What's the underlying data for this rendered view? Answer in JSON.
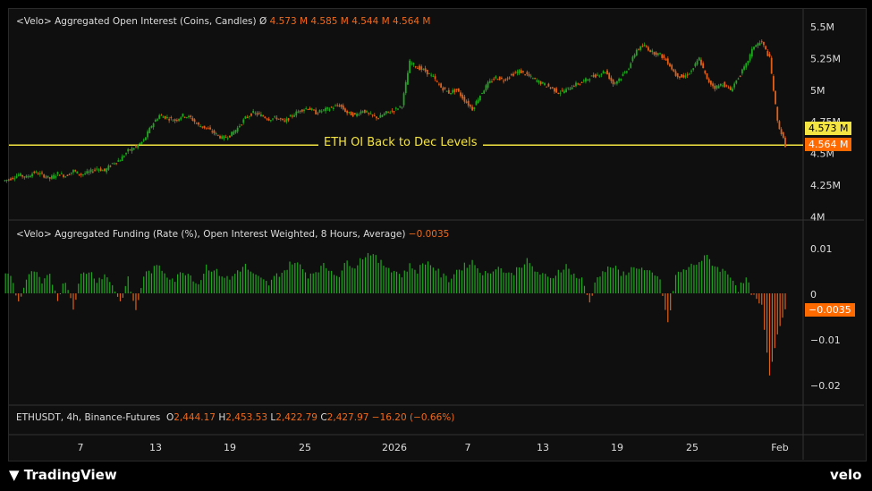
{
  "oi_legend": {
    "title": "<Velo> Aggregated Open Interest (Coins, Candles)",
    "symbol": "Ø",
    "o": "4.573 M",
    "h": "4.585 M",
    "l": "4.544 M",
    "c": "4.564 M"
  },
  "funding_legend": {
    "title": "<Velo> Aggregated Funding (Rate (%), Open Interest Weighted, 8 Hours, Average)",
    "value": "−0.0035"
  },
  "price_legend": {
    "title": "ETHUSDT, 4h, Binance-Futures",
    "o_label": "O",
    "o": "2,444.17",
    "h_label": "H",
    "h": "2,453.53",
    "l_label": "L",
    "l": "2,422.79",
    "c_label": "C",
    "c": "2,427.97",
    "change": "−16.20 (−0.66%)"
  },
  "annotation": "ETH OI Back to Dec Levels",
  "tags": {
    "oi_open": "4.573 M",
    "oi_last": "4.564 M",
    "funding_last": "−0.0035"
  },
  "brand": {
    "left": "TradingView",
    "right": "velo"
  },
  "colors": {
    "up": "#1fa81f",
    "down": "#e0601a",
    "line": "#f5e542",
    "tag_orange": "#ff6a00"
  },
  "chart_data": [
    {
      "type": "candlestick",
      "name": "Open Interest",
      "unit": "M",
      "yticks": [
        "5.5M",
        "5.25M",
        "5M",
        "4.75M",
        "4.5M",
        "4.25M",
        "4M"
      ],
      "ylim": [
        4.0,
        5.5
      ],
      "hline": 4.564,
      "closes": [
        4.3,
        4.33,
        4.31,
        4.35,
        4.33,
        4.3,
        4.34,
        4.32,
        4.36,
        4.33,
        4.35,
        4.38,
        4.36,
        4.42,
        4.45,
        4.52,
        4.55,
        4.6,
        4.72,
        4.8,
        4.78,
        4.76,
        4.8,
        4.78,
        4.72,
        4.7,
        4.66,
        4.62,
        4.64,
        4.7,
        4.78,
        4.82,
        4.8,
        4.77,
        4.78,
        4.75,
        4.8,
        4.84,
        4.86,
        4.82,
        4.84,
        4.86,
        4.88,
        4.82,
        4.8,
        4.84,
        4.8,
        4.78,
        4.82,
        4.84,
        4.88,
        5.22,
        5.18,
        5.15,
        5.1,
        5.02,
        4.98,
        5.0,
        4.92,
        4.85,
        4.96,
        5.05,
        5.1,
        5.08,
        5.12,
        5.15,
        5.12,
        5.08,
        5.05,
        5.02,
        4.98,
        5.0,
        5.04,
        5.06,
        5.1,
        5.12,
        5.15,
        5.05,
        5.1,
        5.18,
        5.32,
        5.35,
        5.3,
        5.28,
        5.22,
        5.12,
        5.1,
        5.15,
        5.25,
        5.08,
        5.02,
        5.05,
        5.0,
        5.1,
        5.2,
        5.35,
        5.38,
        5.25,
        4.75,
        4.564
      ]
    },
    {
      "type": "bar",
      "name": "Funding",
      "yticks": [
        "0.01",
        "0",
        "−0.01",
        "−0.02"
      ],
      "ylim": [
        -0.02,
        0.01
      ],
      "values": [
        0.004,
        -0.002,
        0.003,
        0.005,
        0.002,
        0.004,
        -0.001,
        0.003,
        -0.003,
        0.004,
        0.005,
        0.003,
        0.004,
        0.002,
        -0.002,
        0.003,
        -0.004,
        0.004,
        0.005,
        0.006,
        0.004,
        0.003,
        0.005,
        0.004,
        0.002,
        0.006,
        0.005,
        0.004,
        0.003,
        0.005,
        0.006,
        0.004,
        0.003,
        0.002,
        0.004,
        0.005,
        0.007,
        0.006,
        0.004,
        0.005,
        0.006,
        0.005,
        0.004,
        0.007,
        0.006,
        0.008,
        0.009,
        0.007,
        0.006,
        0.005,
        0.004,
        0.006,
        0.005,
        0.007,
        0.006,
        0.004,
        0.003,
        0.005,
        0.006,
        0.007,
        0.005,
        0.004,
        0.006,
        0.005,
        0.004,
        0.006,
        0.007,
        0.005,
        0.004,
        0.003,
        0.005,
        0.006,
        0.004,
        0.003,
        -0.002,
        0.004,
        0.005,
        0.006,
        0.004,
        0.005,
        0.006,
        0.005,
        0.004,
        0.003,
        -0.007,
        0.004,
        0.005,
        0.006,
        0.007,
        0.008,
        0.006,
        0.005,
        0.004,
        0.001,
        0.003,
        -0.001,
        -0.003,
        -0.018,
        -0.009,
        -0.0035
      ]
    },
    {
      "type": "xaxis",
      "ticks": [
        "7",
        "13",
        "19",
        "25",
        "2026",
        "7",
        "13",
        "19",
        "25",
        "Feb"
      ]
    }
  ]
}
